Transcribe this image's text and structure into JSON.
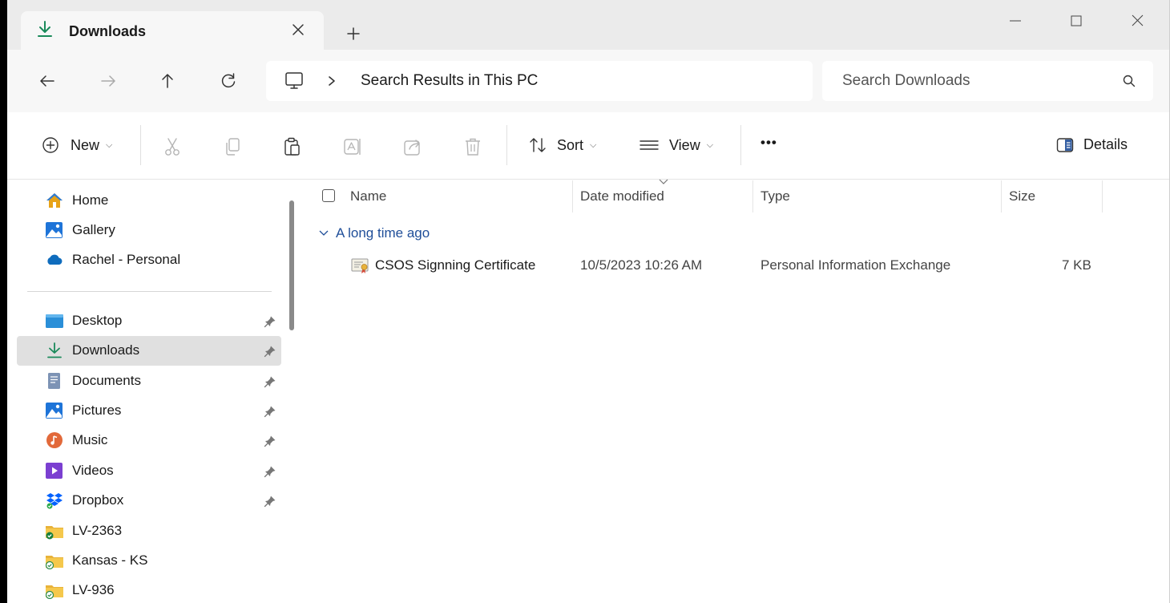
{
  "tab": {
    "title": "Downloads"
  },
  "address": {
    "path": "Search Results in This PC"
  },
  "search": {
    "placeholder": "Search Downloads"
  },
  "commands": {
    "new_label": "New",
    "sort_label": "Sort",
    "view_label": "View",
    "more_label": "•••",
    "details_label": "Details"
  },
  "sidebar": {
    "items": [
      {
        "label": "Home",
        "icon": "home-icon"
      },
      {
        "label": "Gallery",
        "icon": "gallery-icon"
      },
      {
        "label": "Rachel - Personal",
        "icon": "onedrive-cloud-icon"
      },
      {
        "label": "Desktop",
        "icon": "desktop-icon",
        "pinned": true
      },
      {
        "label": "Downloads",
        "icon": "download-icon",
        "pinned": true,
        "selected": true
      },
      {
        "label": "Documents",
        "icon": "documents-icon",
        "pinned": true
      },
      {
        "label": "Pictures",
        "icon": "pictures-icon",
        "pinned": true
      },
      {
        "label": "Music",
        "icon": "music-icon",
        "pinned": true
      },
      {
        "label": "Videos",
        "icon": "videos-icon",
        "pinned": true
      },
      {
        "label": "Dropbox",
        "icon": "dropbox-icon",
        "pinned": true
      },
      {
        "label": "LV-2363",
        "icon": "synced-folder-icon"
      },
      {
        "label": "Kansas - KS",
        "icon": "sync-folder-icon"
      },
      {
        "label": "LV-936",
        "icon": "sync-folder-icon"
      }
    ]
  },
  "columns": {
    "name": "Name",
    "date": "Date modified",
    "type": "Type",
    "size": "Size"
  },
  "group": {
    "label": "A long time ago"
  },
  "files": [
    {
      "name": "CSOS Signning Certificate",
      "date": "10/5/2023 10:26 AM",
      "type": "Personal Information Exchange",
      "size": "7 KB",
      "icon": "certificate-file-icon"
    }
  ],
  "colors": {
    "accent": "#1f4e99",
    "download_green": "#1a8a5a",
    "selection": "#e0e0e0"
  }
}
